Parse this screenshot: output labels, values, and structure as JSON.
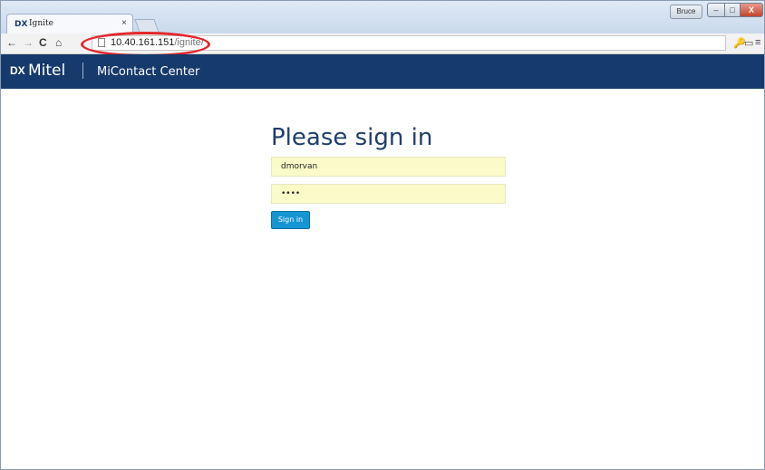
{
  "browser": {
    "tab_icon": "DX",
    "tab_title": "Ignite",
    "tab_close": "×",
    "user_button": "Bruce",
    "window_controls": {
      "minimize": "–",
      "maximize": "□",
      "close": "X"
    },
    "nav": {
      "back": "←",
      "forward": "→",
      "reload": "C",
      "home": "⌂"
    },
    "address": {
      "host": "10.40.161.151",
      "path": "/ignite/"
    },
    "toolbar_right": {
      "key": "🔑",
      "cast": "▭",
      "menu": "≡"
    }
  },
  "app": {
    "logo_mark": "DX",
    "brand": "Mitel",
    "product": "MiContact Center",
    "colors": {
      "header_bg": "#163a6b",
      "button_bg": "#1695d3",
      "field_bg": "#fafbc8"
    }
  },
  "signin": {
    "title": "Please sign in",
    "username": "dmorvan",
    "password_masked": "••••",
    "button_label": "Sign in"
  }
}
